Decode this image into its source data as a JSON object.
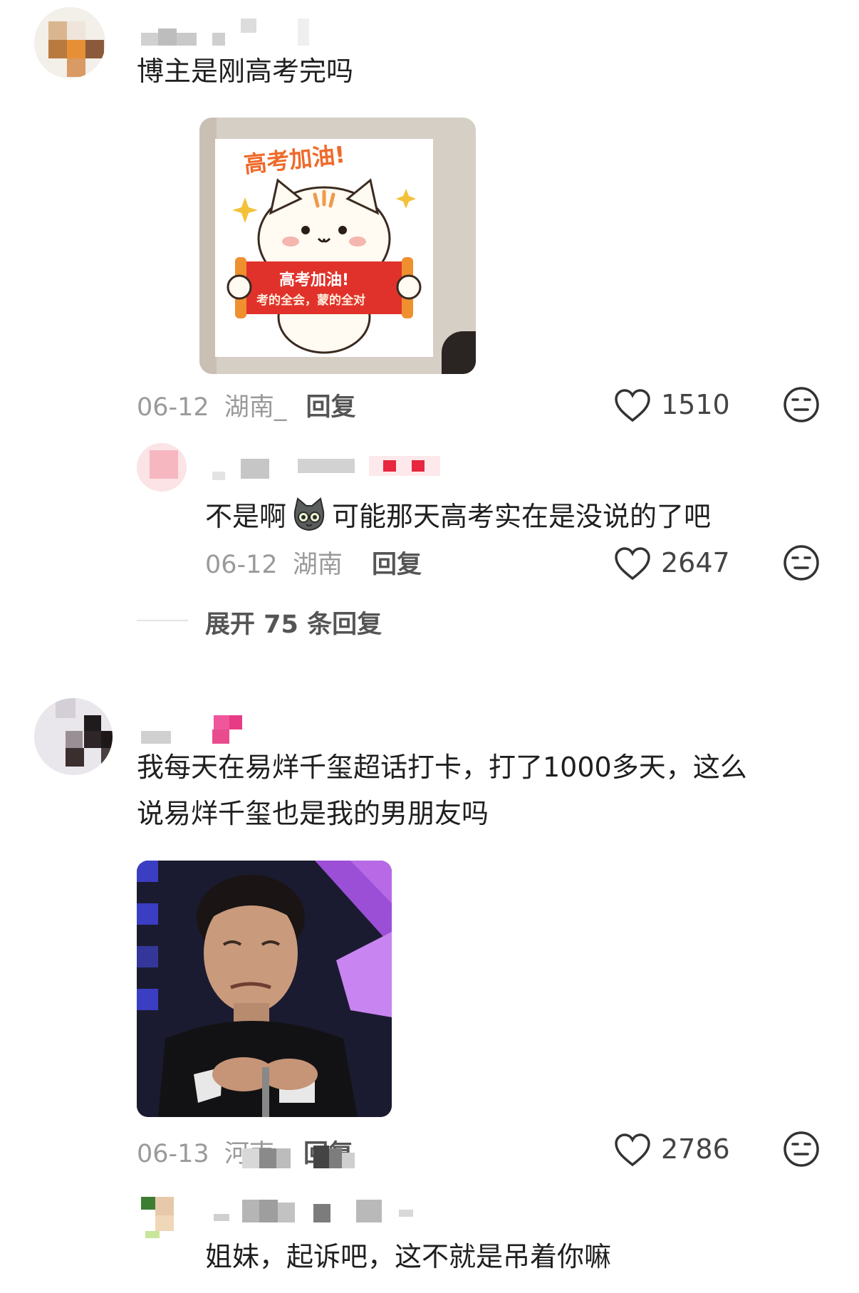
{
  "comments": [
    {
      "text": "博主是刚高考完吗",
      "sticker": {
        "banner_top": "高考加油!",
        "banner_main": "高考加油!",
        "banner_sub": "考的全会，蒙的全对"
      },
      "date": "06-12",
      "location": "湖南_",
      "reply_label": "回复",
      "likes": "1510",
      "replies": [
        {
          "text_before": "不是啊",
          "text_after": "可能那天高考实在是没说的了吧",
          "date": "06-12",
          "location": "湖南",
          "reply_label": "回复",
          "likes": "2647"
        }
      ],
      "expand_label": "展开 75 条回复"
    },
    {
      "text_line1": "我每天在易烊千玺超话打卡，打了1000多天，这么",
      "text_line2": "说易烊千玺也是我的男朋友吗",
      "date": "06-13",
      "location": "河南",
      "reply_label": "回复",
      "likes": "2786",
      "replies": [
        {
          "text": "姐妹，起诉吧，这不就是吊着你嘛"
        }
      ]
    }
  ],
  "icons": {
    "like": "heart-outline-icon",
    "dislike": "neutral-face-icon",
    "emoji_inline": "cat-face-emoji"
  },
  "colors": {
    "text": "#1f1f1f",
    "meta": "#9a9a9a",
    "sticker_red": "#e0322b",
    "sticker_orange": "#ef7d2c"
  }
}
